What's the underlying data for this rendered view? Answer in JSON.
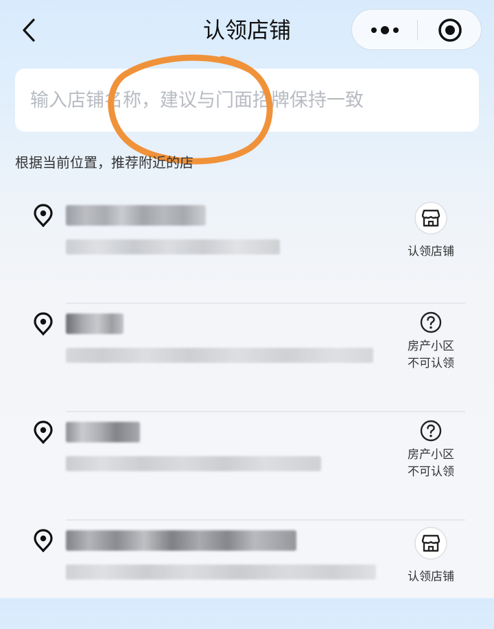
{
  "header": {
    "title": "认领店铺",
    "back_icon": "chevron-left-icon",
    "more_icon": "more-dots-icon",
    "close_icon": "target-circle-icon"
  },
  "search": {
    "placeholder": "输入店铺名称，建议与门面招牌保持一致",
    "value": ""
  },
  "annotation": {
    "shape": "ellipse",
    "color": "#f0923a"
  },
  "hint": "根据当前位置，推荐附近的店",
  "shops": [
    {
      "status": "claimable",
      "action_icon": "store-icon",
      "action_label_1": "认领店铺",
      "action_label_2": ""
    },
    {
      "status": "residential",
      "action_icon": "question-circle-icon",
      "action_label_1": "房产小区",
      "action_label_2": "不可认领"
    },
    {
      "status": "residential",
      "action_icon": "question-circle-icon",
      "action_label_1": "房产小区",
      "action_label_2": "不可认领"
    },
    {
      "status": "claimable",
      "action_icon": "store-icon",
      "action_label_1": "认领店铺",
      "action_label_2": ""
    }
  ],
  "colors": {
    "background_top": "#d8ebfd",
    "background": "#f4f6f9",
    "annotation": "#f0923a",
    "text": "#111111",
    "placeholder": "#b7bbc2"
  }
}
